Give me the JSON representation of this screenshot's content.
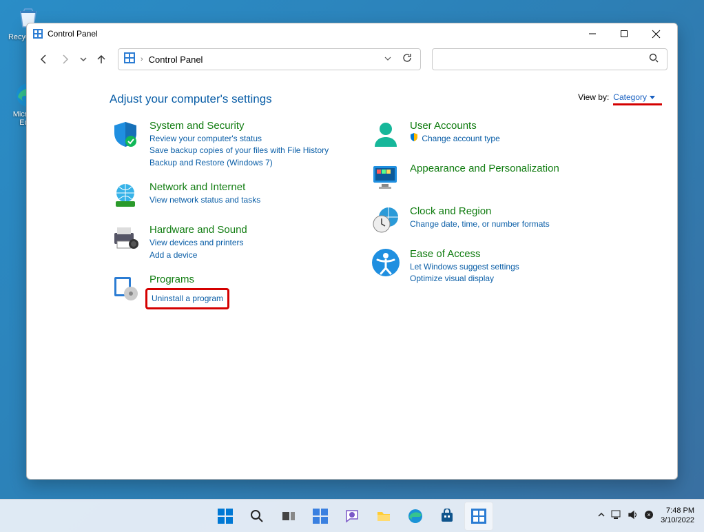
{
  "desktop": {
    "icons": [
      {
        "label": "Recycle Bin"
      },
      {
        "label": "Microsoft Edge"
      }
    ]
  },
  "window": {
    "title": "Control Panel",
    "address": "Control Panel",
    "heading": "Adjust your computer's settings",
    "viewby_label": "View by:",
    "viewby_value": "Category"
  },
  "left_cats": [
    {
      "title": "System and Security",
      "links": [
        "Review your computer's status",
        "Save backup copies of your files with File History",
        "Backup and Restore (Windows 7)"
      ]
    },
    {
      "title": "Network and Internet",
      "links": [
        "View network status and tasks"
      ]
    },
    {
      "title": "Hardware and Sound",
      "links": [
        "View devices and printers",
        "Add a device"
      ]
    },
    {
      "title": "Programs",
      "links": [
        "Uninstall a program"
      ],
      "highlight": 0
    }
  ],
  "right_cats": [
    {
      "title": "User Accounts",
      "links": [
        "Change account type"
      ],
      "shield": [
        0
      ]
    },
    {
      "title": "Appearance and Personalization",
      "links": []
    },
    {
      "title": "Clock and Region",
      "links": [
        "Change date, time, or number formats"
      ]
    },
    {
      "title": "Ease of Access",
      "links": [
        "Let Windows suggest settings",
        "Optimize visual display"
      ]
    }
  ],
  "taskbar": {
    "time": "7:48 PM",
    "date": "3/10/2022"
  }
}
